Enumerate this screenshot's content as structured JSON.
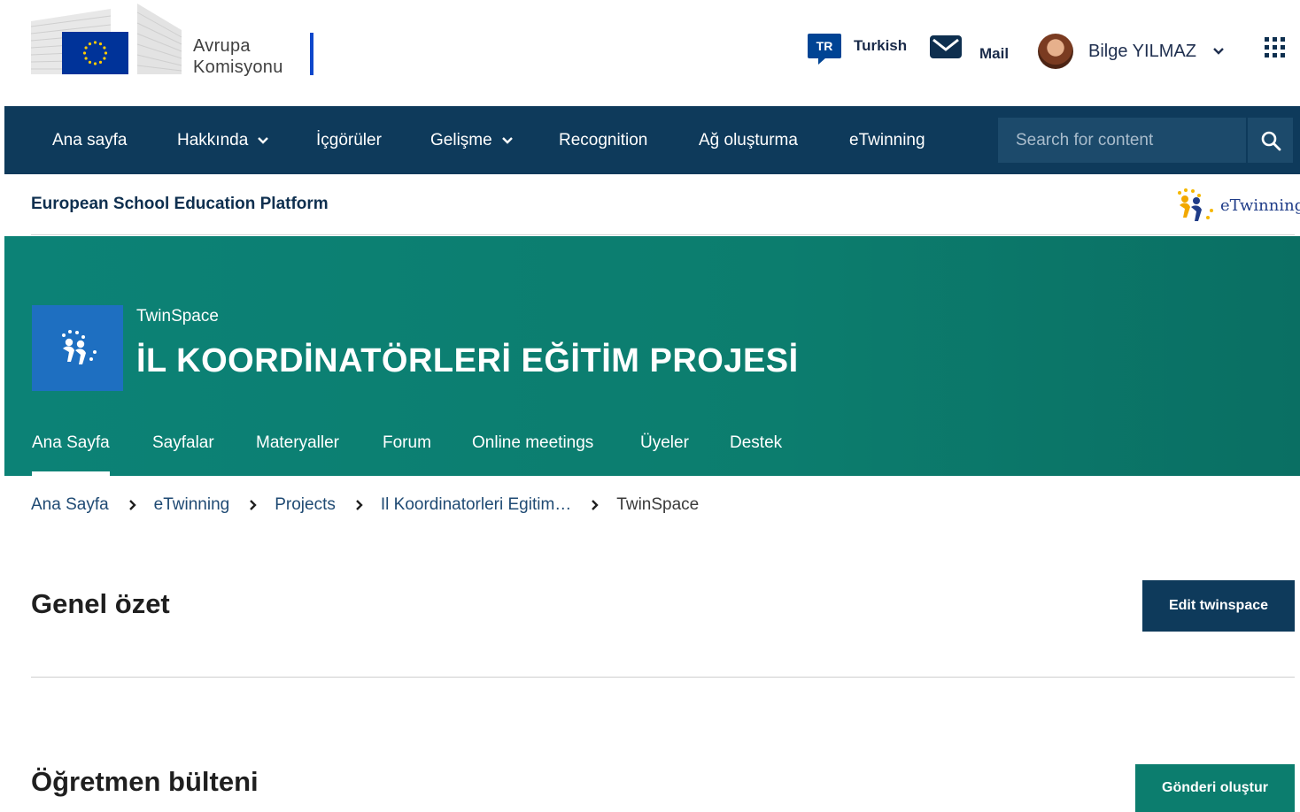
{
  "header": {
    "logo_line1": "Avrupa",
    "logo_line2": "Komisyonu",
    "language_code": "TR",
    "language_label": "Turkish",
    "mail_label": "Mail",
    "user_name": "Bilge YILMAZ"
  },
  "nav": {
    "items": [
      {
        "label": "Ana sayfa"
      },
      {
        "label": "Hakkında"
      },
      {
        "label": "İçgörüler"
      },
      {
        "label": "Gelişme"
      },
      {
        "label": "Recognition"
      },
      {
        "label": "Ağ oluşturma"
      },
      {
        "label": "eTwinning"
      }
    ],
    "search_placeholder": "Search for content"
  },
  "platform": {
    "title": "European School Education Platform",
    "etwinning_logo_text": "eTwinning"
  },
  "hero": {
    "kicker": "TwinSpace",
    "title": "İL KOORDİNATÖRLERİ EĞİTİM PROJESİ",
    "tabs": [
      {
        "label": "Ana Sayfa",
        "active": true
      },
      {
        "label": "Sayfalar"
      },
      {
        "label": "Materyaller"
      },
      {
        "label": "Forum"
      },
      {
        "label": "Online meetings"
      },
      {
        "label": "Üyeler"
      },
      {
        "label": "Destek"
      }
    ]
  },
  "breadcrumb": [
    {
      "label": "Ana Sayfa"
    },
    {
      "label": "eTwinning"
    },
    {
      "label": "Projects"
    },
    {
      "label": "Il Koordinatorleri Egitim…"
    },
    {
      "label": "TwinSpace"
    }
  ],
  "sections": {
    "overview_title": "Genel özet",
    "edit_button": "Edit twinspace",
    "bulletin_title": "Öğretmen bülteni",
    "create_post_button": "Gönderi oluştur"
  },
  "colors": {
    "nav_bg": "#0e3a5b",
    "hero_bg": "#0c8276",
    "edit_button_bg": "#0e3a5b",
    "post_button_bg": "#0c7d6e"
  }
}
